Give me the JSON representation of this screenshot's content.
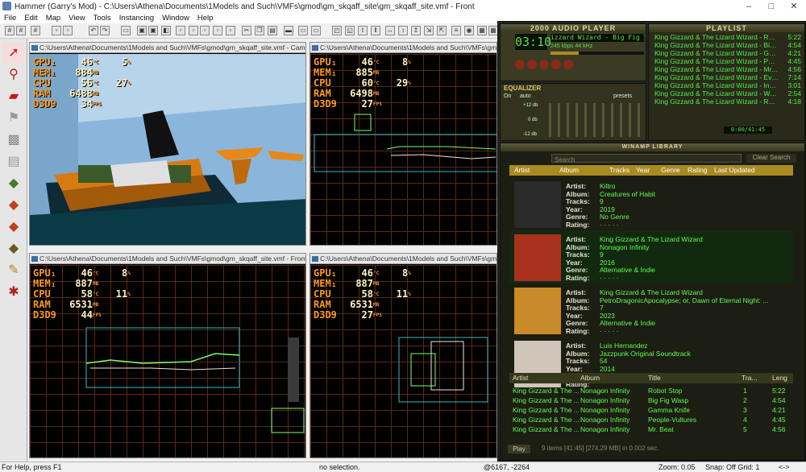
{
  "window": {
    "title": "Hammer (Garry's Mod) - C:\\Users\\Athena\\Documents\\1Models and Such\\VMFs\\gmod\\gm_skqaff_site\\gm_skqaff_site.vmf - Front",
    "min": "–",
    "max": "□",
    "close": "✕"
  },
  "menu": [
    "File",
    "Edit",
    "Map",
    "View",
    "Tools",
    "Instancing",
    "Window",
    "Help"
  ],
  "viewports": [
    {
      "title": "C:\\Users\\Athena\\Documents\\1Models and Such\\VMFs\\gmod\\gm_skqaff_site.vmf - Camera",
      "hud": {
        "gpu": "46",
        "gpu2": "5",
        "mem": "884",
        "cpu": "56",
        "cpu2": "27",
        "ram": "6488",
        "d3d": "34"
      }
    },
    {
      "title": "C:\\Users\\Athena\\Documents\\1Models and Such\\VMFs\\gmod\\gm_skqaff_site.vmf - Top",
      "hud": {
        "gpu": "46",
        "gpu2": "8",
        "mem": "885",
        "cpu": "60",
        "cpu2": "29",
        "ram": "6498",
        "d3d": "27"
      }
    },
    {
      "title": "C:\\Users\\Athena\\Documents\\1Models and Such\\VMFs\\gmod\\gm_skqaff_site.vmf - Front",
      "hud": {
        "gpu": "46",
        "gpu2": "8",
        "mem": "887",
        "cpu": "58",
        "cpu2": "11",
        "ram": "6531",
        "d3d": "44"
      }
    },
    {
      "title": "C:\\Users\\Athena\\Documents\\1Models and Such\\VMFs\\gmod\\gm_skqaff_site.vmf - Side",
      "hud": {
        "gpu": "46",
        "gpu2": "8",
        "mem": "887",
        "cpu": "58",
        "cpu2": "11",
        "ram": "6531",
        "d3d": "27"
      }
    }
  ],
  "hud_labels": {
    "gpu": "GPU₁",
    "mem": "MEM₁",
    "cpu": "CPU",
    "ram": "RAM",
    "d3d": "D3D9",
    "deg": "°C",
    "pct": "%",
    "mb": "MB",
    "fps": "FPS"
  },
  "status": {
    "help": "For Help, press F1",
    "selection": "no selection.",
    "coords": "@6167, -2264",
    "zoom": "Zoom: 0.05",
    "snap": "Snap: Off Grid: 1",
    "arrows": "<->"
  },
  "winamp": {
    "player_title": "2000 AUDIO PLAYER",
    "time": "03:10",
    "song": "izzard Wizard - Big Fig Wasp (4:54",
    "bitrate": "245",
    "khz": "44",
    "kbps_label": "kbps",
    "khz_label": "kHz",
    "eq_title": "EQUALIZER",
    "eq_on": "On",
    "eq_auto": "auto",
    "eq_presets": "presets",
    "eq_db": [
      "+12 db",
      "0 db",
      "-12 db"
    ],
    "playlist_title": "PLAYLIST",
    "playlist_time": "0:00/41:45",
    "playlist": [
      {
        "n": "1",
        "t": "King Gizzard & The Lizard Wizard - Rob...",
        "d": "5:22"
      },
      {
        "n": "2",
        "t": "King Gizzard & The Lizard Wizard - Big ...",
        "d": "4:54"
      },
      {
        "n": "3",
        "t": "King Gizzard & The Lizard Wizard - Gam...",
        "d": "4:21"
      },
      {
        "n": "4",
        "t": "King Gizzard & The Lizard Wizard - Peo...",
        "d": "4:45"
      },
      {
        "n": "5",
        "t": "King Gizzard & The Lizard Wizard - Mr. B...",
        "d": "4:56"
      },
      {
        "n": "6",
        "t": "King Gizzard & The Lizard Wizard - Evil ...",
        "d": "7:14"
      },
      {
        "n": "7",
        "t": "King Gizzard & The Lizard Wizard - Invis...",
        "d": "3:01"
      },
      {
        "n": "8",
        "t": "King Gizzard & The Lizard Wizard - Wah...",
        "d": "2:54"
      },
      {
        "n": "9",
        "t": "King Gizzard & The Lizard Wizard - Roa...",
        "d": "4:18"
      }
    ],
    "library_title": "WINAMP LIBRARY",
    "search_label": "Search",
    "clear_search": "Clear Search",
    "album_cols": [
      "Artist",
      "Album",
      "Tracks",
      "Year",
      "Genre",
      "Rating",
      "Last Updated"
    ],
    "field_labels": {
      "artist": "Artist:",
      "album": "Album:",
      "tracks": "Tracks:",
      "year": "Year:",
      "genre": "Genre:",
      "rating": "Rating:"
    },
    "albums": [
      {
        "artist": "Kiltro",
        "album": "Creatures of Habit",
        "tracks": "9",
        "year": "2019",
        "genre": "No Genre",
        "rating": "· · · · ·",
        "cover": "#2a2a2a"
      },
      {
        "artist": "King Gizzard & The Lizard Wizard",
        "album": "Nonagon Infinity",
        "tracks": "9",
        "year": "2016",
        "genre": "Alternative & Indie",
        "rating": "· · · · ·",
        "cover": "#a8321e"
      },
      {
        "artist": "King Gizzard & The Lizard Wizard",
        "album": "PetroDragonicApocalypse; or, Dawn of Eternal Night: ...",
        "tracks": "7",
        "year": "2023",
        "genre": "Alternative & Indie",
        "rating": "· · · · ·",
        "cover": "#c98a2a"
      },
      {
        "artist": "Luis Hernandez",
        "album": "Jazzpunk Original Soundtrack",
        "tracks": "54",
        "year": "2014",
        "genre": "",
        "rating": "",
        "cover": "#cfc5b8"
      }
    ],
    "track_cols": [
      "Artist",
      "Album",
      "Title",
      "Tra...",
      "Leng"
    ],
    "tracks": [
      {
        "artist": "King Gizzard & The ...",
        "album": "Nonagon Infinity",
        "title": "Robot Stop",
        "n": "1",
        "len": "5:22"
      },
      {
        "artist": "King Gizzard & The ...",
        "album": "Nonagon Infinity",
        "title": "Big Fig Wasp",
        "n": "2",
        "len": "4:54"
      },
      {
        "artist": "King Gizzard & The ...",
        "album": "Nonagon Infinity",
        "title": "Gamma Knife",
        "n": "3",
        "len": "4:21"
      },
      {
        "artist": "King Gizzard & The ...",
        "album": "Nonagon Infinity",
        "title": "People-Vultures",
        "n": "4",
        "len": "4:45"
      },
      {
        "artist": "King Gizzard & The ...",
        "album": "Nonagon Infinity",
        "title": "Mr. Beat",
        "n": "5",
        "len": "4:56"
      }
    ],
    "play_button": "Play",
    "footer": "9 items [41:45] [274.29 MB] in 0.002 sec."
  }
}
